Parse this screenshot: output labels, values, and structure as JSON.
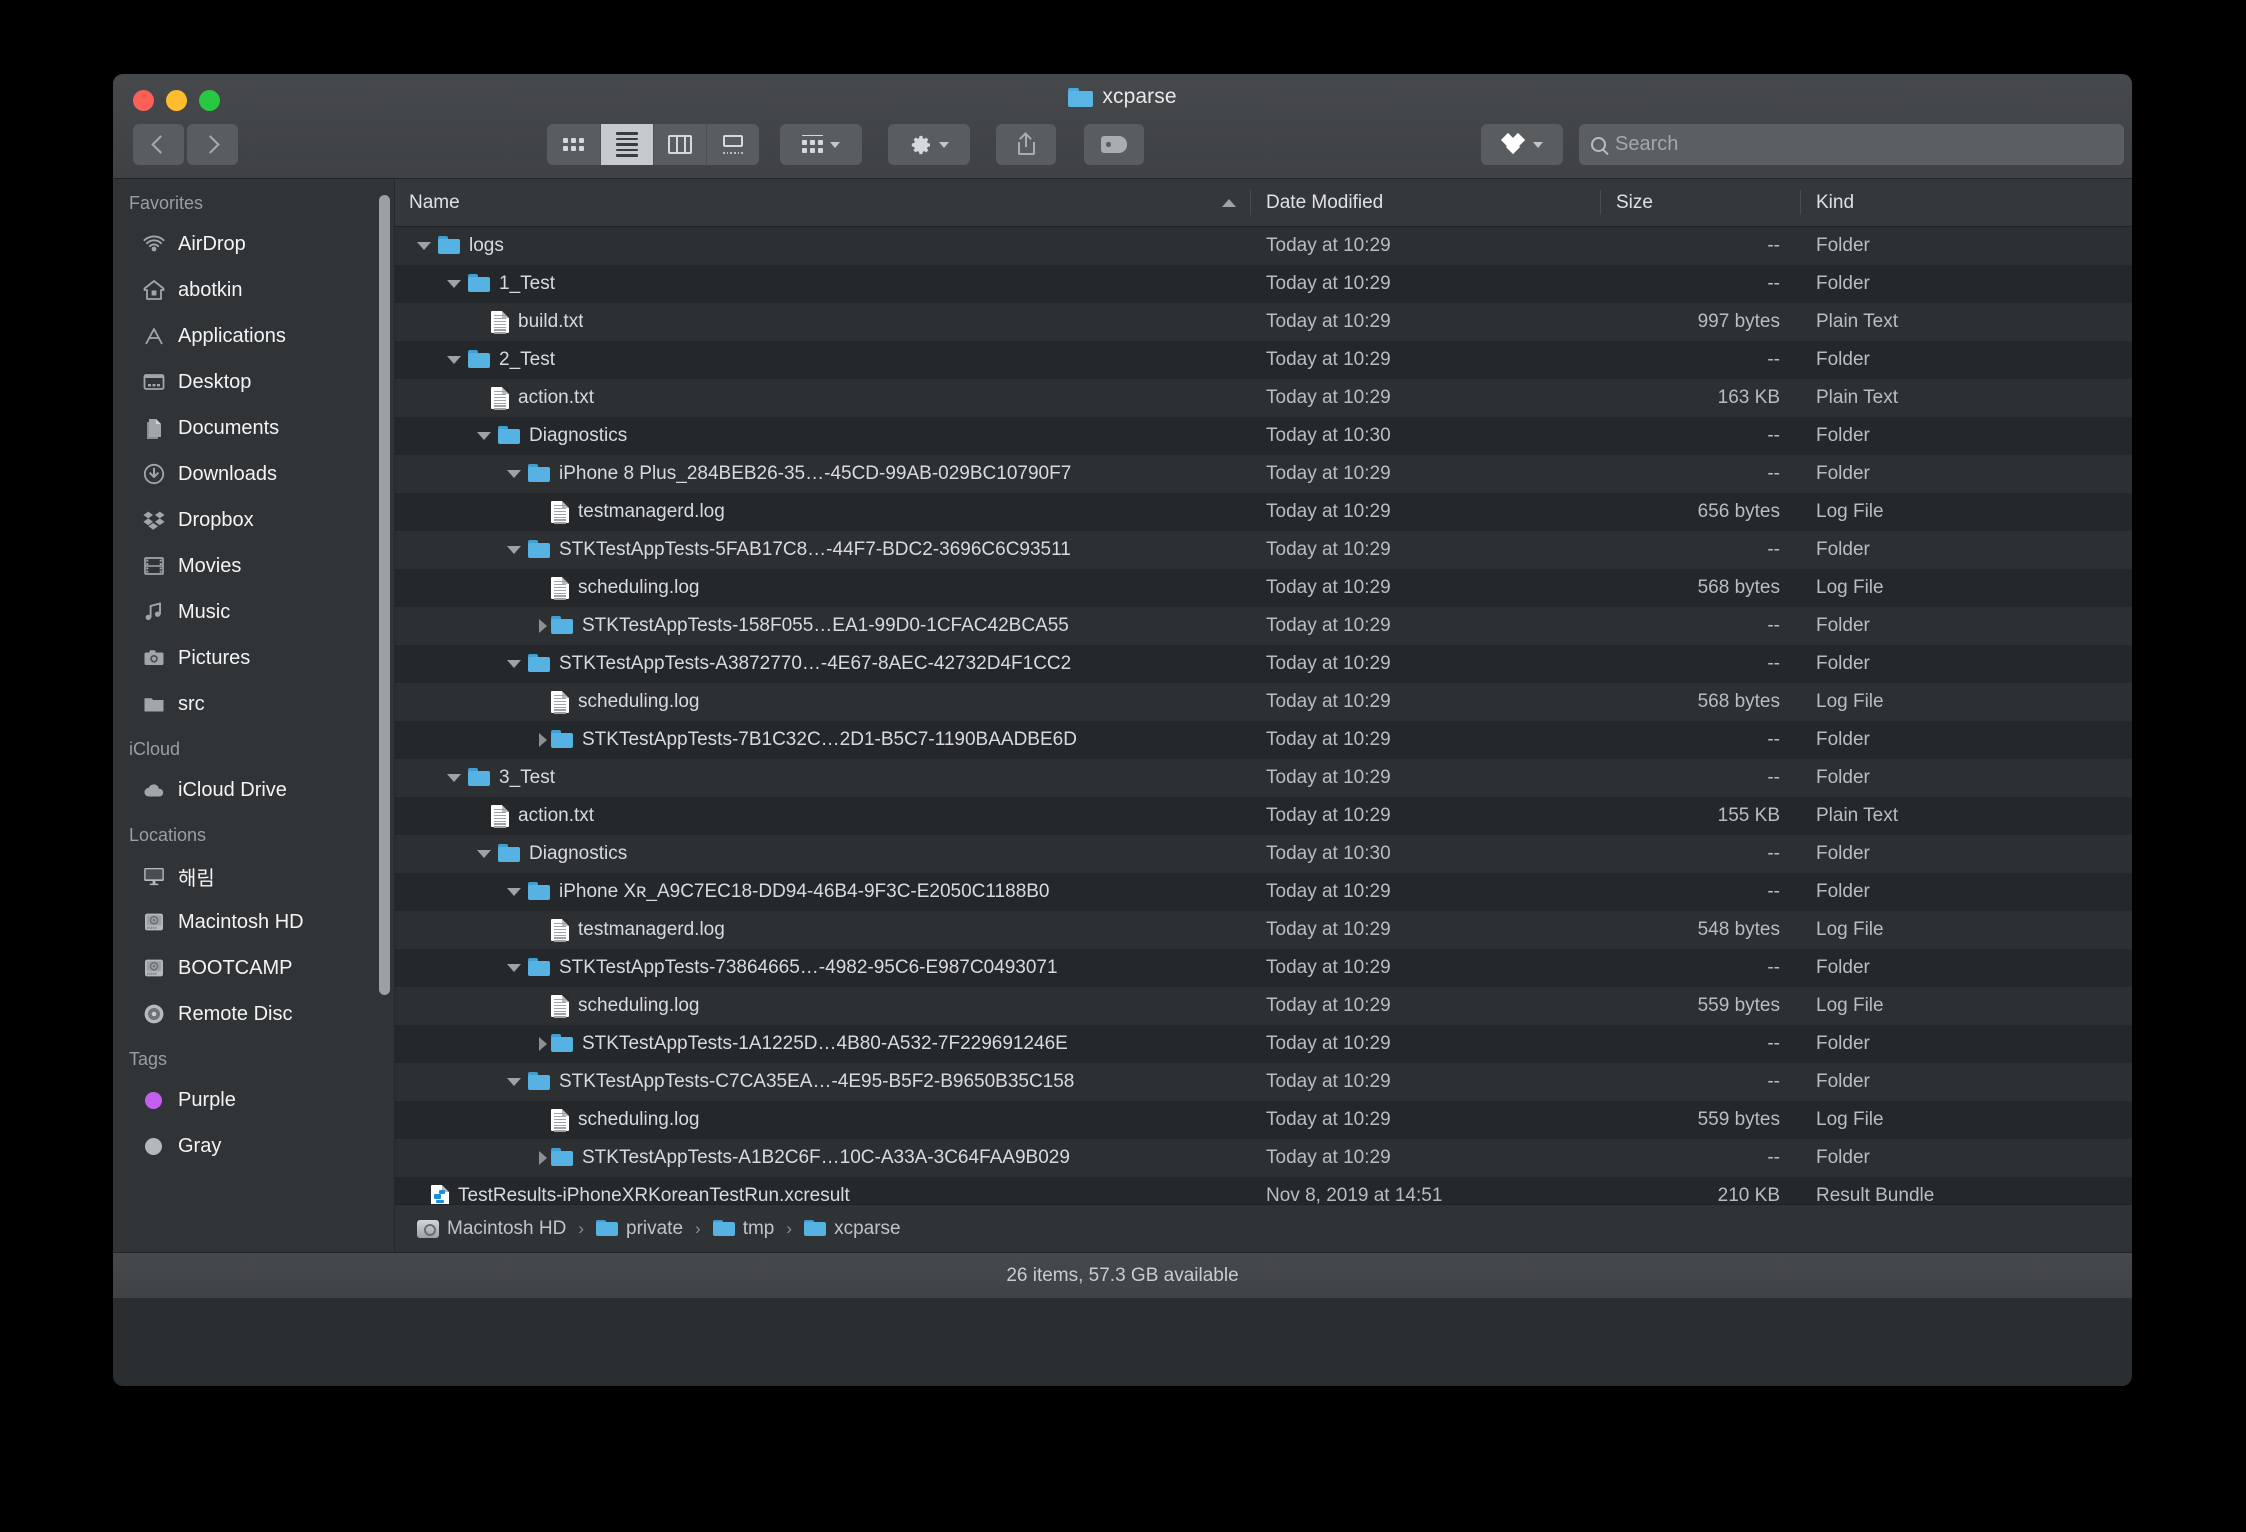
{
  "window": {
    "title": "xcparse",
    "traffic_lights": [
      "close",
      "minimize",
      "zoom"
    ]
  },
  "toolbar": {
    "back_label": "Back",
    "forward_label": "Forward",
    "view_modes": [
      {
        "name": "icon-view",
        "label": "Icon View",
        "active": false
      },
      {
        "name": "list-view",
        "label": "List View",
        "active": true
      },
      {
        "name": "column-view",
        "label": "Column View",
        "active": false
      },
      {
        "name": "gallery-view",
        "label": "Gallery View",
        "active": false
      }
    ],
    "group_label": "Group",
    "action_label": "Action",
    "share_label": "Share",
    "tag_label": "Tags",
    "dropbox_label": "Dropbox"
  },
  "search": {
    "placeholder": "Search",
    "value": ""
  },
  "sidebar": {
    "sections": [
      {
        "header": "Favorites",
        "items": [
          {
            "label": "AirDrop",
            "icon": "airdrop-icon"
          },
          {
            "label": "abotkin",
            "icon": "home-icon"
          },
          {
            "label": "Applications",
            "icon": "applications-icon"
          },
          {
            "label": "Desktop",
            "icon": "desktop-icon"
          },
          {
            "label": "Documents",
            "icon": "documents-icon"
          },
          {
            "label": "Downloads",
            "icon": "downloads-icon"
          },
          {
            "label": "Dropbox",
            "icon": "dropbox-icon"
          },
          {
            "label": "Movies",
            "icon": "movies-icon"
          },
          {
            "label": "Music",
            "icon": "music-icon"
          },
          {
            "label": "Pictures",
            "icon": "pictures-icon"
          },
          {
            "label": "src",
            "icon": "folder-icon"
          }
        ]
      },
      {
        "header": "iCloud",
        "items": [
          {
            "label": "iCloud Drive",
            "icon": "cloud-icon"
          }
        ]
      },
      {
        "header": "Locations",
        "items": [
          {
            "label": "해림",
            "icon": "display-icon"
          },
          {
            "label": "Macintosh HD",
            "icon": "harddisk-icon"
          },
          {
            "label": "BOOTCAMP",
            "icon": "harddisk-icon"
          },
          {
            "label": "Remote Disc",
            "icon": "disc-icon"
          }
        ]
      },
      {
        "header": "Tags",
        "items": [
          {
            "label": "Purple",
            "icon": "tag-dot-icon",
            "color": "#c45ef0"
          },
          {
            "label": "Gray",
            "icon": "tag-dot-icon",
            "color": "#b4b8bb"
          }
        ]
      }
    ]
  },
  "columns": {
    "name": "Name",
    "date_modified": "Date Modified",
    "size": "Size",
    "kind": "Kind",
    "sort_column": "Name",
    "sort_direction": "ascending"
  },
  "rows": [
    {
      "indent": 0,
      "disclosure": "open",
      "icon": "folder",
      "name": "logs",
      "date": "Today at 10:29",
      "size": "--",
      "kind": "Folder"
    },
    {
      "indent": 1,
      "disclosure": "open",
      "icon": "folder",
      "name": "1_Test",
      "date": "Today at 10:29",
      "size": "--",
      "kind": "Folder"
    },
    {
      "indent": 2,
      "disclosure": "none",
      "icon": "doc",
      "name": "build.txt",
      "date": "Today at 10:29",
      "size": "997 bytes",
      "kind": "Plain Text"
    },
    {
      "indent": 1,
      "disclosure": "open",
      "icon": "folder",
      "name": "2_Test",
      "date": "Today at 10:29",
      "size": "--",
      "kind": "Folder"
    },
    {
      "indent": 2,
      "disclosure": "none",
      "icon": "doc",
      "name": "action.txt",
      "date": "Today at 10:29",
      "size": "163 KB",
      "kind": "Plain Text"
    },
    {
      "indent": 2,
      "disclosure": "open",
      "icon": "folder",
      "name": "Diagnostics",
      "date": "Today at 10:30",
      "size": "--",
      "kind": "Folder"
    },
    {
      "indent": 3,
      "disclosure": "open",
      "icon": "folder",
      "name": "iPhone 8 Plus_284BEB26-35…-45CD-99AB-029BC10790F7",
      "date": "Today at 10:29",
      "size": "--",
      "kind": "Folder"
    },
    {
      "indent": 4,
      "disclosure": "none",
      "icon": "doc",
      "name": "testmanagerd.log",
      "date": "Today at 10:29",
      "size": "656 bytes",
      "kind": "Log File"
    },
    {
      "indent": 3,
      "disclosure": "open",
      "icon": "folder",
      "name": "STKTestAppTests-5FAB17C8…-44F7-BDC2-3696C6C93511",
      "date": "Today at 10:29",
      "size": "--",
      "kind": "Folder"
    },
    {
      "indent": 4,
      "disclosure": "none",
      "icon": "doc",
      "name": "scheduling.log",
      "date": "Today at 10:29",
      "size": "568 bytes",
      "kind": "Log File"
    },
    {
      "indent": 4,
      "disclosure": "closed",
      "icon": "folder",
      "name": "STKTestAppTests-158F055…EA1-99D0-1CFAC42BCA55",
      "date": "Today at 10:29",
      "size": "--",
      "kind": "Folder"
    },
    {
      "indent": 3,
      "disclosure": "open",
      "icon": "folder",
      "name": "STKTestAppTests-A3872770…-4E67-8AEC-42732D4F1CC2",
      "date": "Today at 10:29",
      "size": "--",
      "kind": "Folder"
    },
    {
      "indent": 4,
      "disclosure": "none",
      "icon": "doc",
      "name": "scheduling.log",
      "date": "Today at 10:29",
      "size": "568 bytes",
      "kind": "Log File"
    },
    {
      "indent": 4,
      "disclosure": "closed",
      "icon": "folder",
      "name": "STKTestAppTests-7B1C32C…2D1-B5C7-1190BAADBE6D",
      "date": "Today at 10:29",
      "size": "--",
      "kind": "Folder"
    },
    {
      "indent": 1,
      "disclosure": "open",
      "icon": "folder",
      "name": "3_Test",
      "date": "Today at 10:29",
      "size": "--",
      "kind": "Folder"
    },
    {
      "indent": 2,
      "disclosure": "none",
      "icon": "doc",
      "name": "action.txt",
      "date": "Today at 10:29",
      "size": "155 KB",
      "kind": "Plain Text"
    },
    {
      "indent": 2,
      "disclosure": "open",
      "icon": "folder",
      "name": "Diagnostics",
      "date": "Today at 10:30",
      "size": "--",
      "kind": "Folder"
    },
    {
      "indent": 3,
      "disclosure": "open",
      "icon": "folder",
      "name": "iPhone Xʀ_A9C7EC18-DD94-46B4-9F3C-E2050C1188B0",
      "date": "Today at 10:29",
      "size": "--",
      "kind": "Folder"
    },
    {
      "indent": 4,
      "disclosure": "none",
      "icon": "doc",
      "name": "testmanagerd.log",
      "date": "Today at 10:29",
      "size": "548 bytes",
      "kind": "Log File"
    },
    {
      "indent": 3,
      "disclosure": "open",
      "icon": "folder",
      "name": "STKTestAppTests-73864665…-4982-95C6-E987C0493071",
      "date": "Today at 10:29",
      "size": "--",
      "kind": "Folder"
    },
    {
      "indent": 4,
      "disclosure": "none",
      "icon": "doc",
      "name": "scheduling.log",
      "date": "Today at 10:29",
      "size": "559 bytes",
      "kind": "Log File"
    },
    {
      "indent": 4,
      "disclosure": "closed",
      "icon": "folder",
      "name": "STKTestAppTests-1A1225D…4B80-A532-7F229691246E",
      "date": "Today at 10:29",
      "size": "--",
      "kind": "Folder"
    },
    {
      "indent": 3,
      "disclosure": "open",
      "icon": "folder",
      "name": "STKTestAppTests-C7CA35EA…-4E95-B5F2-B9650B35C158",
      "date": "Today at 10:29",
      "size": "--",
      "kind": "Folder"
    },
    {
      "indent": 4,
      "disclosure": "none",
      "icon": "doc",
      "name": "scheduling.log",
      "date": "Today at 10:29",
      "size": "559 bytes",
      "kind": "Log File"
    },
    {
      "indent": 4,
      "disclosure": "closed",
      "icon": "folder",
      "name": "STKTestAppTests-A1B2C6F…10C-A33A-3C64FAA9B029",
      "date": "Today at 10:29",
      "size": "--",
      "kind": "Folder"
    },
    {
      "indent": 0,
      "disclosure": "none",
      "icon": "bundle",
      "name": "TestResults-iPhoneXRKoreanTestRun.xcresult",
      "date": "Nov 8, 2019 at 14:51",
      "size": "210 KB",
      "kind": "Result Bundle"
    }
  ],
  "path_bar": [
    {
      "label": "Macintosh HD",
      "icon": "harddisk-icon"
    },
    {
      "label": "private",
      "icon": "folder-icon"
    },
    {
      "label": "tmp",
      "icon": "folder-icon"
    },
    {
      "label": "xcparse",
      "icon": "folder-icon"
    }
  ],
  "status_bar": {
    "text": "26 items, 57.3 GB available"
  }
}
